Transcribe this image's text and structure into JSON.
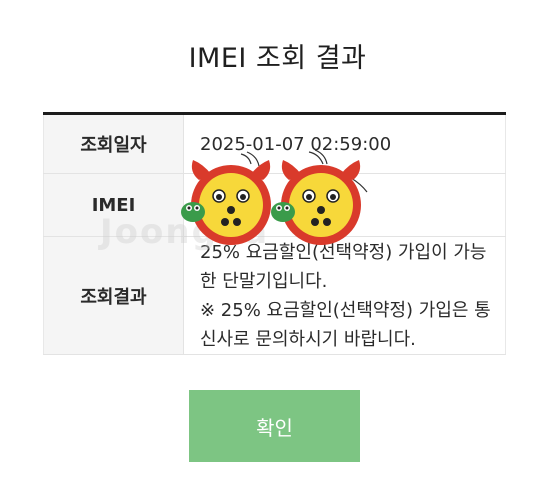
{
  "page": {
    "title": "IMEI 조회 결과"
  },
  "table": {
    "rows": [
      {
        "label": "조회일자",
        "value": "2025-01-07 02:59:00"
      },
      {
        "label": "IMEI",
        "value": ""
      },
      {
        "label": "조회결과",
        "value": "25% 요금할인(선택약정) 가입이 가능한 단말기입니다.\n※ 25% 요금할인(선택약정) 가입은 통신사로 문의하시기 바랍니다."
      }
    ]
  },
  "watermark": {
    "text": "Joongna"
  },
  "buttons": {
    "confirm_label": "확인"
  },
  "colors": {
    "button_bg": "#7dc583",
    "table_top_border": "#1c1c1c",
    "header_cell_bg": "#f5f5f5",
    "mascot_face": "#f7d83a",
    "mascot_outline": "#d93a2b",
    "mascot_bug": "#3a9b4a"
  },
  "icons": {
    "sticker": "mascot-sticker-icon"
  }
}
